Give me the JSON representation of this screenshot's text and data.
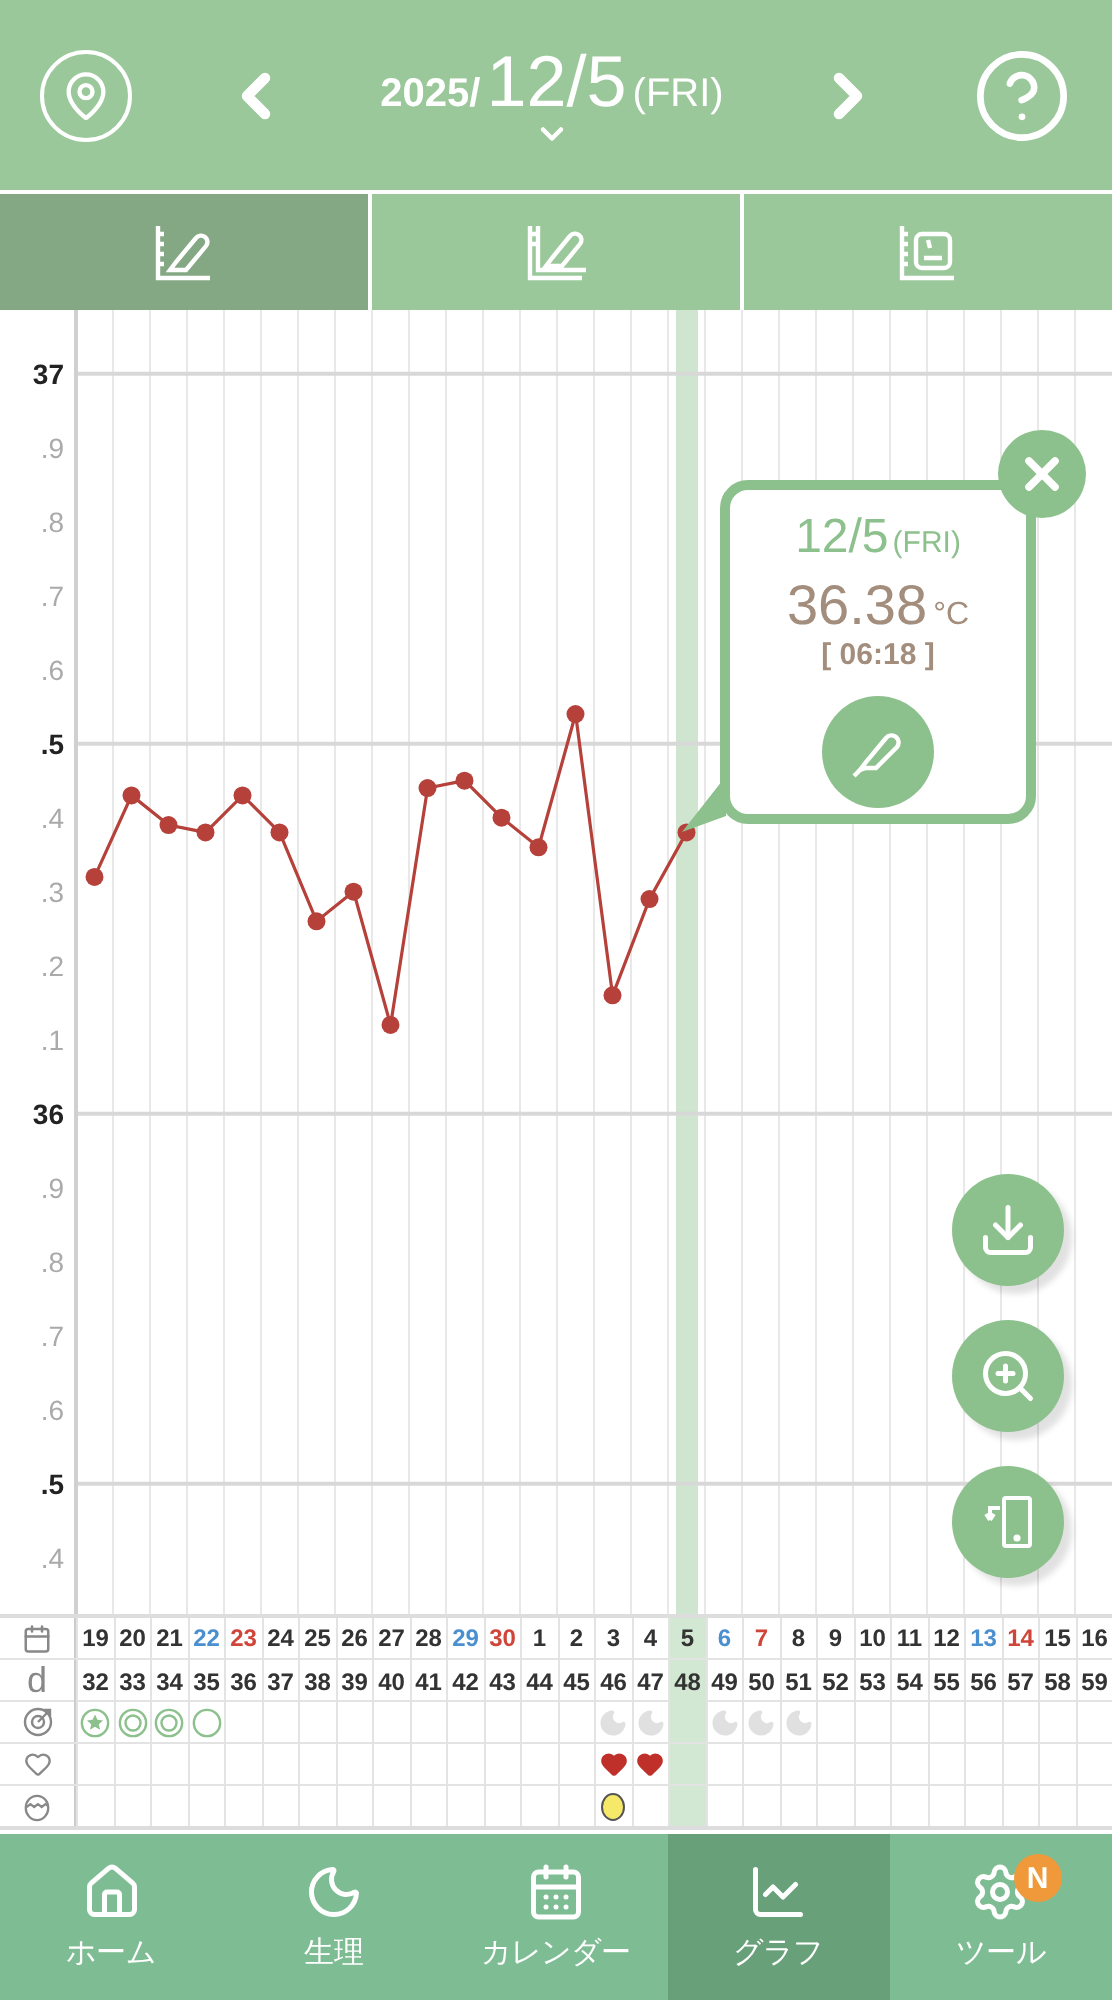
{
  "header": {
    "year": "2025/",
    "date": "12/5",
    "weekday": "(FRI)"
  },
  "tabs": [
    {
      "kind": "single",
      "selected": true
    },
    {
      "kind": "overlay",
      "selected": false
    },
    {
      "kind": "weight",
      "selected": false
    }
  ],
  "chart": {
    "y_label_groups": [
      {
        "labels": [
          {
            "label": ".9",
            "major": false
          },
          {
            "label": ".8",
            "major": false
          },
          {
            "label": ".7",
            "major": false
          },
          {
            "label": ".6",
            "major": false
          },
          {
            "label": ".5",
            "major": true
          },
          {
            "label": ".4",
            "major": false
          },
          {
            "label": ".3",
            "major": false
          },
          {
            "label": ".2",
            "major": false
          },
          {
            "label": ".1",
            "major": false
          }
        ]
      },
      {
        "labels": [
          {
            "label": ".9",
            "major": false
          },
          {
            "label": ".8",
            "major": false
          },
          {
            "label": ".7",
            "major": false
          },
          {
            "label": ".6",
            "major": false
          },
          {
            "label": ".5",
            "major": true
          },
          {
            "label": ".4",
            "major": false
          }
        ]
      }
    ],
    "chart_data": {
      "type": "line",
      "ylim": [
        35.324,
        37.086
      ],
      "yticks": [
        37,
        36
      ],
      "grid": true,
      "series": [
        {
          "color": "#b5413a",
          "marker": "o",
          "values": [
            36.32,
            36.43,
            36.39,
            36.38,
            36.43,
            36.38,
            36.26,
            36.3,
            36.12,
            36.44,
            36.45,
            36.4,
            36.36,
            36.54,
            36.16,
            36.29,
            36.38,
            null,
            null,
            null,
            null,
            null,
            null,
            null,
            null,
            null,
            null,
            null
          ]
        }
      ]
    }
  },
  "popup": {
    "date": "12/5",
    "weekday": "(FRI)",
    "temperature": "36.38",
    "unit": "°C",
    "time": "[ 06:18 ]"
  },
  "table": {
    "cycle_label": "d",
    "columns": [
      {
        "date": "19",
        "color": "#333333",
        "cycle_day": "32",
        "symbol": {
          "kind": "star"
        },
        "heart": false,
        "egg": false,
        "selected": false
      },
      {
        "date": "20",
        "color": "#333333",
        "cycle_day": "33",
        "symbol": {
          "kind": "double"
        },
        "heart": false,
        "egg": false,
        "selected": false
      },
      {
        "date": "21",
        "color": "#333333",
        "cycle_day": "34",
        "symbol": {
          "kind": "double"
        },
        "heart": false,
        "egg": false,
        "selected": false
      },
      {
        "date": "22",
        "color": "#4a8fd0",
        "cycle_day": "35",
        "symbol": {
          "kind": "ring"
        },
        "heart": false,
        "egg": false,
        "selected": false
      },
      {
        "date": "23",
        "color": "#d0453a",
        "cycle_day": "36",
        "heart": false,
        "egg": false,
        "selected": false
      },
      {
        "date": "24",
        "color": "#333333",
        "cycle_day": "37",
        "heart": false,
        "egg": false,
        "selected": false
      },
      {
        "date": "25",
        "color": "#333333",
        "cycle_day": "38",
        "heart": false,
        "egg": false,
        "selected": false
      },
      {
        "date": "26",
        "color": "#333333",
        "cycle_day": "39",
        "heart": false,
        "egg": false,
        "selected": false
      },
      {
        "date": "27",
        "color": "#333333",
        "cycle_day": "40",
        "heart": false,
        "egg": false,
        "selected": false
      },
      {
        "date": "28",
        "color": "#333333",
        "cycle_day": "41",
        "heart": false,
        "egg": false,
        "selected": false
      },
      {
        "date": "29",
        "color": "#4a8fd0",
        "cycle_day": "42",
        "heart": false,
        "egg": false,
        "selected": false
      },
      {
        "date": "30",
        "color": "#d0453a",
        "cycle_day": "43",
        "heart": false,
        "egg": false,
        "selected": false
      },
      {
        "date": "1",
        "color": "#333333",
        "cycle_day": "44",
        "heart": false,
        "egg": false,
        "selected": false
      },
      {
        "date": "2",
        "color": "#333333",
        "cycle_day": "45",
        "heart": false,
        "egg": false,
        "selected": false
      },
      {
        "date": "3",
        "color": "#333333",
        "cycle_day": "46",
        "symbol": {
          "kind": "moon"
        },
        "heart": true,
        "egg": true,
        "selected": false
      },
      {
        "date": "4",
        "color": "#333333",
        "cycle_day": "47",
        "symbol": {
          "kind": "moon"
        },
        "heart": true,
        "egg": false,
        "selected": false
      },
      {
        "date": "5",
        "color": "#333333",
        "cycle_day": "48",
        "heart": false,
        "egg": false,
        "selected": true
      },
      {
        "date": "6",
        "color": "#4a8fd0",
        "cycle_day": "49",
        "symbol": {
          "kind": "moon"
        },
        "heart": false,
        "egg": false,
        "selected": false
      },
      {
        "date": "7",
        "color": "#d0453a",
        "cycle_day": "50",
        "symbol": {
          "kind": "moon"
        },
        "heart": false,
        "egg": false,
        "selected": false
      },
      {
        "date": "8",
        "color": "#333333",
        "cycle_day": "51",
        "symbol": {
          "kind": "moon"
        },
        "heart": false,
        "egg": false,
        "selected": false
      },
      {
        "date": "9",
        "color": "#333333",
        "cycle_day": "52",
        "heart": false,
        "egg": false,
        "selected": false
      },
      {
        "date": "10",
        "color": "#333333",
        "cycle_day": "53",
        "heart": false,
        "egg": false,
        "selected": false
      },
      {
        "date": "11",
        "color": "#333333",
        "cycle_day": "54",
        "heart": false,
        "egg": false,
        "selected": false
      },
      {
        "date": "12",
        "color": "#333333",
        "cycle_day": "55",
        "heart": false,
        "egg": false,
        "selected": false
      },
      {
        "date": "13",
        "color": "#4a8fd0",
        "cycle_day": "56",
        "heart": false,
        "egg": false,
        "selected": false
      },
      {
        "date": "14",
        "color": "#d0453a",
        "cycle_day": "57",
        "heart": false,
        "egg": false,
        "selected": false
      },
      {
        "date": "15",
        "color": "#333333",
        "cycle_day": "58",
        "heart": false,
        "egg": false,
        "selected": false
      },
      {
        "date": "16",
        "color": "#333333",
        "cycle_day": "59",
        "heart": false,
        "egg": false,
        "selected": false
      }
    ]
  },
  "nav": [
    {
      "kind": "home",
      "label": "ホーム",
      "selected": false
    },
    {
      "kind": "period",
      "label": "生理",
      "selected": false
    },
    {
      "kind": "calendar",
      "label": "カレンダー",
      "selected": false
    },
    {
      "kind": "graph",
      "label": "グラフ",
      "selected": true
    },
    {
      "kind": "tools",
      "label": "ツール",
      "selected": false,
      "badge": "N"
    }
  ]
}
